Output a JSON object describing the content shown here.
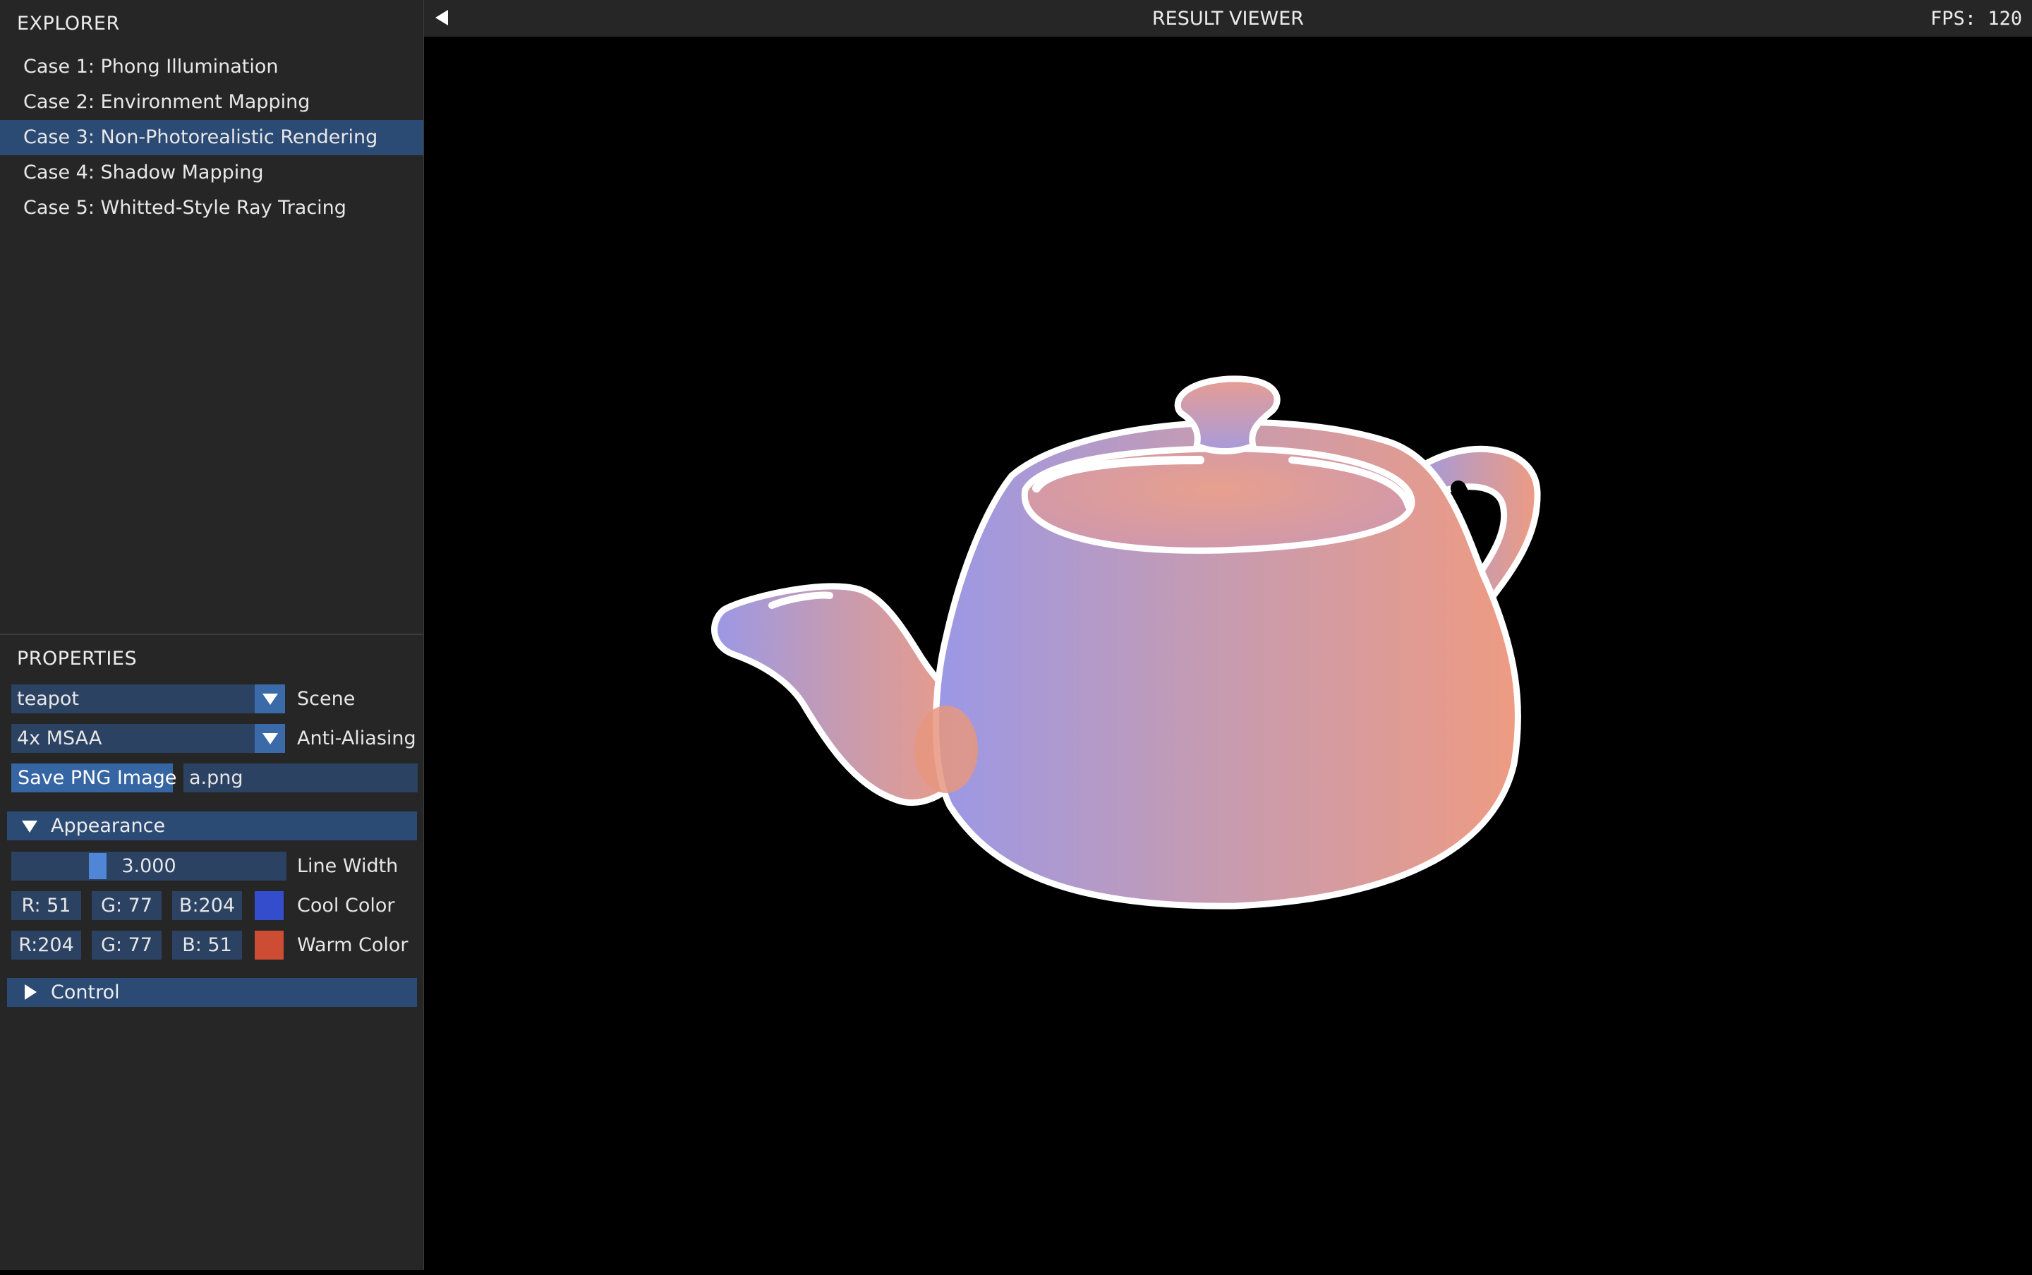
{
  "explorer": {
    "title": "EXPLORER",
    "items": [
      {
        "label": "Case 1: Phong Illumination"
      },
      {
        "label": "Case 2: Environment Mapping"
      },
      {
        "label": "Case 3: Non-Photorealistic Rendering",
        "selected": true
      },
      {
        "label": "Case 4: Shadow Mapping"
      },
      {
        "label": "Case 5: Whitted-Style Ray Tracing"
      }
    ]
  },
  "properties": {
    "title": "PROPERTIES",
    "scene": {
      "value": "teapot",
      "label": "Scene"
    },
    "anti_aliasing": {
      "value": "4x MSAA",
      "label": "Anti-Aliasing"
    },
    "save": {
      "button_label": "Save PNG Image",
      "filename": "a.png"
    },
    "appearance": {
      "header": "Appearance",
      "expanded": true,
      "line_width": {
        "value": "3.000",
        "label": "Line Width",
        "fraction": 0.3
      },
      "cool_color": {
        "r": "R: 51",
        "g": "G: 77",
        "b": "B:204",
        "label": "Cool Color",
        "hex": "#334dcc"
      },
      "warm_color": {
        "r": "R:204",
        "g": "G: 77",
        "b": "B: 51",
        "label": "Warm Color",
        "hex": "#cc4d33"
      }
    },
    "control": {
      "header": "Control",
      "expanded": false
    }
  },
  "viewer": {
    "title": "RESULT VIEWER",
    "fps": "FPS: 120"
  },
  "icons": {
    "collapse": "triangle-left-icon",
    "dropdown": "triangle-down-icon",
    "expanded": "triangle-down-icon",
    "collapsed": "triangle-right-icon"
  },
  "colors": {
    "accent": "#3665a3",
    "selection": "#2b4a74",
    "field": "#2c4263",
    "panel": "#262626",
    "viewport": "#000000"
  }
}
